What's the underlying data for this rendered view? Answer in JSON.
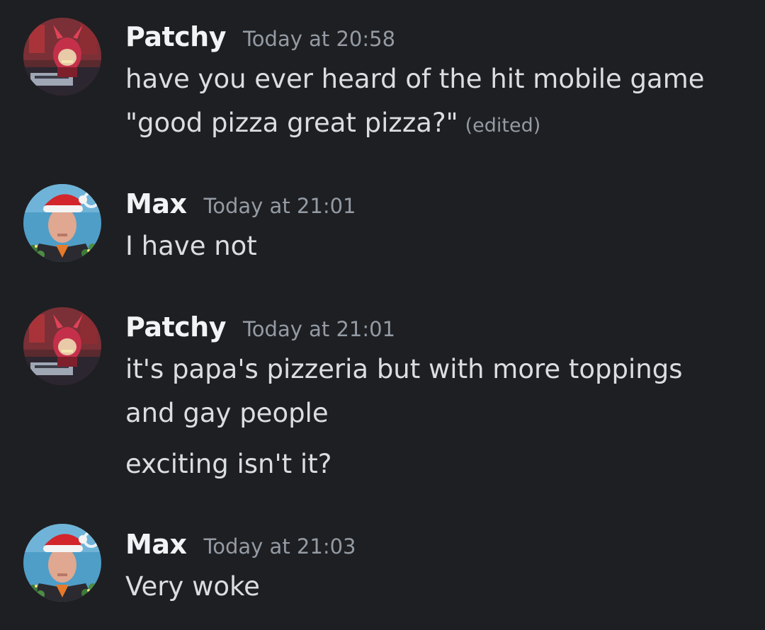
{
  "messages": [
    {
      "username": "Patchy",
      "timestamp": "Today at 20:58",
      "avatar": "demon-character-avatar",
      "lines": [
        "have you ever heard of the hit mobile game",
        "\"good pizza great pizza?\""
      ],
      "edited_label": "(edited)"
    },
    {
      "username": "Max",
      "timestamp": "Today at 21:01",
      "avatar": "santa-hat-man-avatar",
      "lines": [
        "I have not"
      ]
    },
    {
      "username": "Patchy",
      "timestamp": "Today at 21:01",
      "avatar": "demon-character-avatar",
      "lines": [
        "it's papa's pizzeria but with more toppings",
        "and gay people",
        "exciting isn't it?"
      ]
    },
    {
      "username": "Max",
      "timestamp": "Today at 21:03",
      "avatar": "santa-hat-man-avatar",
      "lines": [
        "Very woke"
      ]
    }
  ],
  "colors": {
    "background": "#1e1f22",
    "username": "#f2f3f5",
    "timestamp": "#949ba4",
    "message_text": "#dbdee1"
  }
}
